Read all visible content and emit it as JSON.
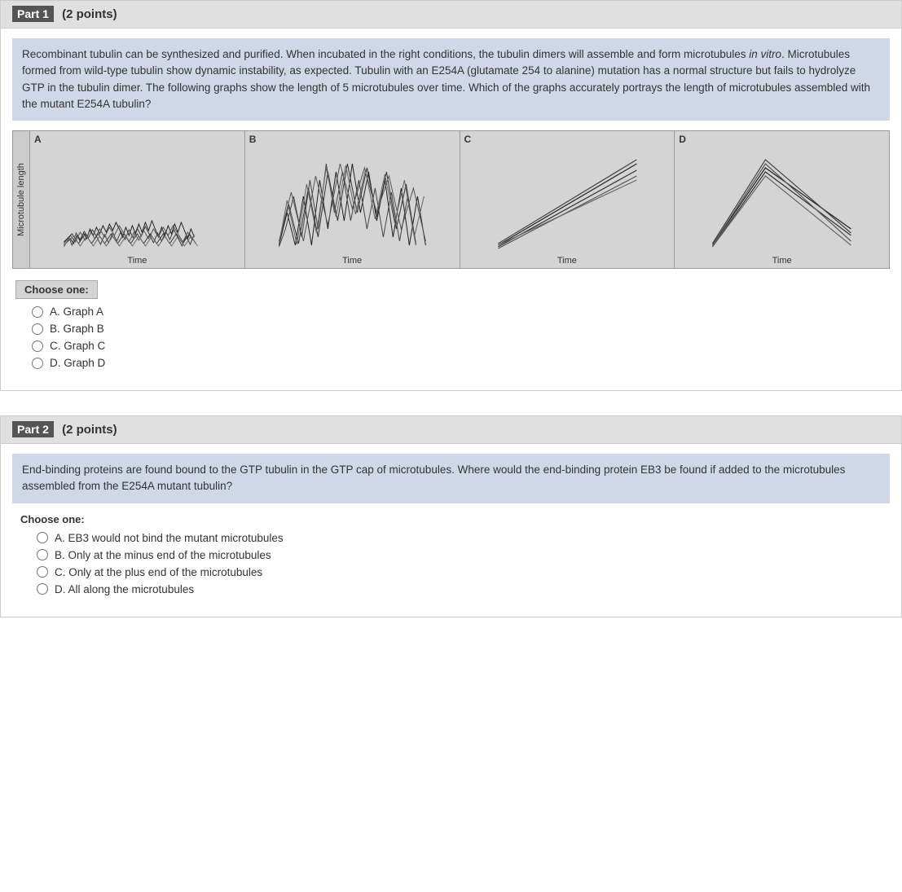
{
  "part1": {
    "header": "Part 1",
    "points": "(2 points)",
    "question": "Recombinant tubulin can be synthesized and purified. When incubated in the right conditions, the tubulin dimers will assemble and form microtubules in vitro. Microtubules formed from wild-type tubulin show dynamic instability, as expected. Tubulin with an E254A (glutamate 254 to alanine) mutation has a normal structure but fails to hydrolyze GTP in the tubulin dimer. The following graphs show the length of 5 microtubules over time. Which of the graphs accurately portrays the length of microtubules assembled with the mutant E254A tubulin?",
    "y_axis_label": "Microtubule length",
    "graphs": [
      {
        "label": "A",
        "x_label": "Time"
      },
      {
        "label": "B",
        "x_label": "Time"
      },
      {
        "label": "C",
        "x_label": "Time"
      },
      {
        "label": "D",
        "x_label": "Time"
      }
    ],
    "choose_one": "Choose one:",
    "options": [
      {
        "id": "opt-a",
        "value": "A",
        "label": "A.  Graph A"
      },
      {
        "id": "opt-b",
        "value": "B",
        "label": "B.  Graph B"
      },
      {
        "id": "opt-c",
        "value": "C",
        "label": "C.  Graph C"
      },
      {
        "id": "opt-d",
        "value": "D",
        "label": "D.  Graph D"
      }
    ]
  },
  "part2": {
    "header": "Part 2",
    "points": "(2 points)",
    "question": "End-binding proteins are found bound to the GTP tubulin in the GTP cap of microtubules. Where would the end-binding protein EB3 be found if added to the microtubules assembled from the E254A mutant tubulin?",
    "choose_one": "Choose one:",
    "options": [
      {
        "id": "opt2-a",
        "value": "A",
        "label": "A.  EB3 would not bind the mutant microtubules"
      },
      {
        "id": "opt2-b",
        "value": "B",
        "label": "B.  Only at the minus end of the microtubules"
      },
      {
        "id": "opt2-c",
        "value": "C",
        "label": "C.  Only at the plus end of the microtubules"
      },
      {
        "id": "opt2-d",
        "value": "D",
        "label": "D.  All along the microtubules"
      }
    ]
  }
}
